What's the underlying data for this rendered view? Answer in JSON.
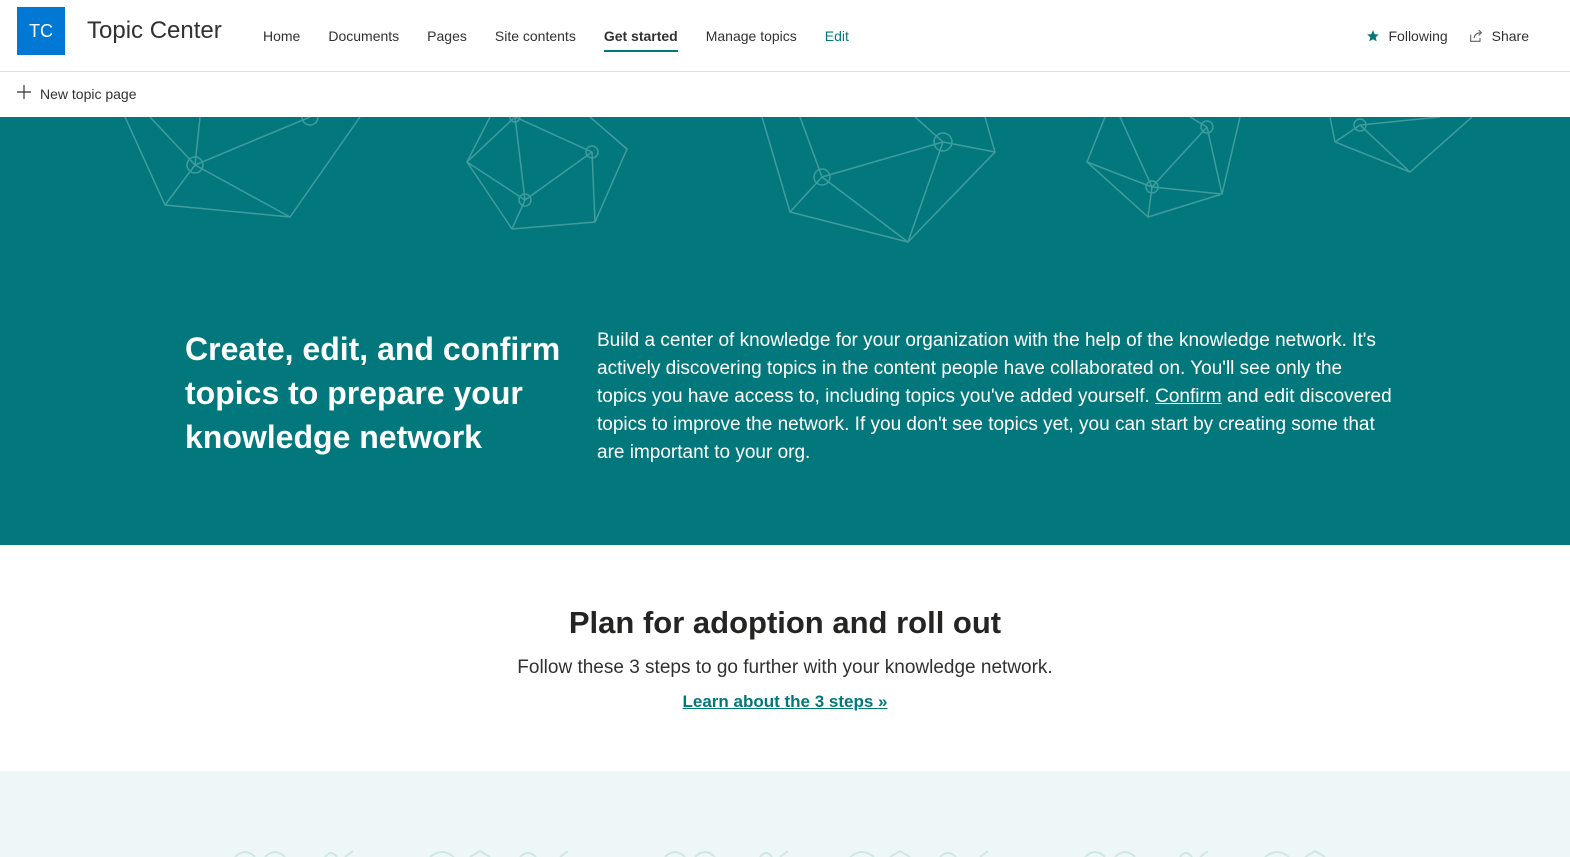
{
  "header": {
    "logo_initials": "TC",
    "site_title": "Topic Center",
    "nav": [
      {
        "label": "Home"
      },
      {
        "label": "Documents"
      },
      {
        "label": "Pages"
      },
      {
        "label": "Site contents"
      },
      {
        "label": "Get started",
        "active": true
      },
      {
        "label": "Manage topics"
      },
      {
        "label": "Edit"
      }
    ],
    "following_label": "Following",
    "share_label": "Share"
  },
  "command_bar": {
    "new_topic_page_label": "New topic page"
  },
  "hero": {
    "heading": "Create, edit, and confirm topics to prepare your knowledge network",
    "body_before_link": "Build a center of knowledge for your organization with the help of the knowledge network. It's actively discovering topics in the content people have collaborated on. You'll see only the topics you have access to, including topics you've added yourself. ",
    "link_label": "Confirm",
    "body_after_link": " and edit discovered topics to improve the network. If you don't see topics yet, you can start by creating some that are important to your org."
  },
  "plan": {
    "title": "Plan for adoption and roll out",
    "subtitle": "Follow these 3 steps to go further with your knowledge network.",
    "link_label": "Learn about the 3 steps »"
  },
  "colors": {
    "theme_teal": "#03787c",
    "logo_blue": "#0078d4",
    "band_bg": "#eef7f7"
  },
  "icons": {
    "following": "star-icon",
    "share": "share-icon",
    "new_page": "plus-icon"
  }
}
